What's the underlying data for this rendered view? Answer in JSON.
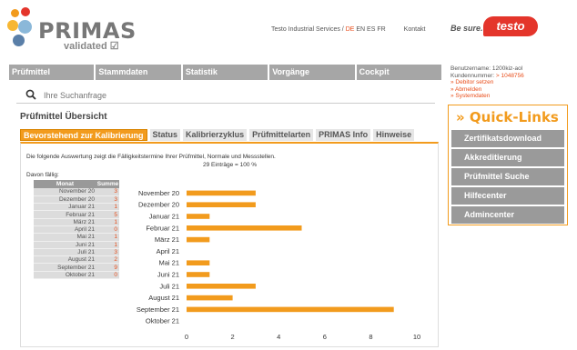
{
  "header": {
    "logo_title": "PRIMAS",
    "logo_sub": "validated",
    "links_prefix": "Testo Industrial Services / ",
    "lang_selected": "DE",
    "lang_rest": " EN ES FR",
    "kontakt": "Kontakt",
    "besure": "Be sure.",
    "brand": "testo"
  },
  "nav": [
    "Prüfmittel",
    "Stammdaten",
    "Statistik",
    "Vorgänge",
    "Cockpit"
  ],
  "search": {
    "placeholder": "Ihre Suchanfrage"
  },
  "page_title": "Prüfmittel Übersicht",
  "tabs": [
    "Bevorstehend zur Kalibrierung",
    "Status",
    "Kalibrierzyklus",
    "Prüfmittelarten",
    "PRIMAS Info",
    "Hinweise"
  ],
  "content": {
    "description": "Die folgende Auswertung zeigt die Fälligkeitstermine Ihrer Prüfmittel, Normale und Messstellen.",
    "count": "29 Einträge = 100 %",
    "davon": "Davon fällig:",
    "table_headers": [
      "Monat",
      "Summe"
    ]
  },
  "user": {
    "line1": "Benutzername: 1200kiz-aol",
    "line2_label": "Kundennummer: ",
    "line2_value": "> 1048756",
    "links": [
      "» Debitor setzen",
      "» Abmelden",
      "» Systemdaten"
    ]
  },
  "quick_links": {
    "title": "» Quick-Links",
    "items": [
      "Zertifikatsdownload",
      "Akkreditierung",
      "Prüfmittel Suche",
      "Hilfecenter",
      "Admincenter"
    ]
  },
  "colors": {
    "accent": "#f29b1d",
    "brand": "#e4352b",
    "nav": "#a6a6a6"
  },
  "chart_data": {
    "type": "bar",
    "orientation": "horizontal",
    "categories": [
      "November 20",
      "Dezember 20",
      "Januar 21",
      "Februar 21",
      "März 21",
      "April 21",
      "Mai 21",
      "Juni 21",
      "Juli 21",
      "August 21",
      "September 21",
      "Oktober 21"
    ],
    "values": [
      3,
      3,
      1,
      5,
      1,
      0,
      1,
      1,
      3,
      2,
      9,
      0
    ],
    "xlim": [
      0,
      10
    ],
    "xticks": [
      0,
      2,
      4,
      6,
      8,
      10
    ],
    "color": "#f29b1d",
    "grid": false
  }
}
